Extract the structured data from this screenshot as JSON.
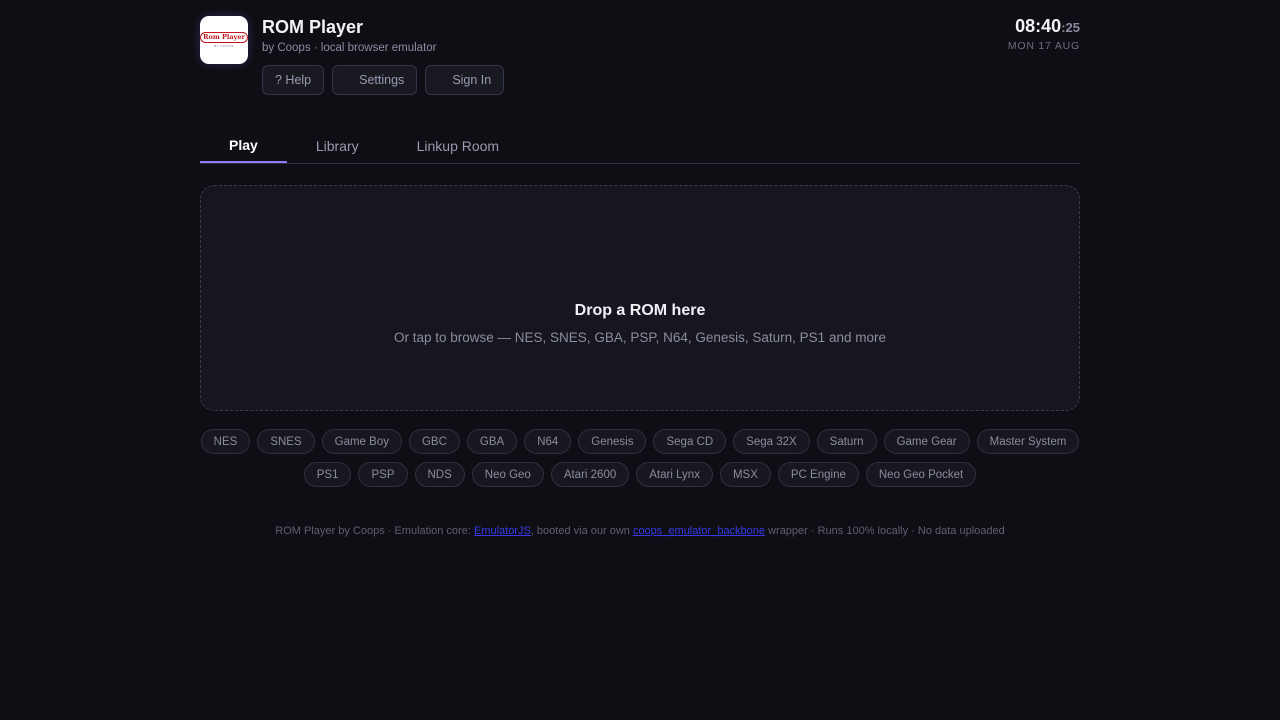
{
  "app": {
    "title": "ROM Player",
    "subtitle": "by Coops · local browser emulator",
    "logo_text": "Rom Player",
    "logo_subtext": "BY COOPS"
  },
  "header_buttons": [
    {
      "label": "? Help",
      "icon": ""
    },
    {
      "label": "Settings",
      "icon": "gear-icon"
    },
    {
      "label": "Sign In",
      "icon": "user-icon"
    }
  ],
  "clock": {
    "time": "08:40",
    "seconds": ":25",
    "date": "MON 17 AUG"
  },
  "tabs": [
    {
      "label": "Play",
      "active": true
    },
    {
      "label": "Library",
      "active": false
    },
    {
      "label": "Linkup Room",
      "active": false
    }
  ],
  "dropzone": {
    "title": "Drop a ROM here",
    "subtitle": "Or tap to browse — NES, SNES, GBA, PSP, N64, Genesis, Saturn, PS1 and more"
  },
  "systems_row1": [
    "NES",
    "SNES",
    "Game Boy",
    "GBC",
    "GBA",
    "N64",
    "Genesis",
    "Sega CD",
    "Sega 32X",
    "Saturn",
    "Game Gear",
    "Master System"
  ],
  "systems_row2": [
    "PS1",
    "PSP",
    "NDS",
    "Neo Geo",
    "Atari 2600",
    "Atari Lynx",
    "MSX",
    "PC Engine",
    "Neo Geo Pocket"
  ],
  "footer": {
    "prefix": "ROM Player by Coops · Emulation core: ",
    "link1": "EmulatorJS",
    "middle": ", booted via our own ",
    "link2": "coops_emulator_backbone",
    "suffix": " wrapper · Runs 100% locally · No data uploaded"
  },
  "colors": {
    "background": "#0e0e14",
    "accent": "#8b7cf6",
    "link": "#3a3ae8"
  }
}
